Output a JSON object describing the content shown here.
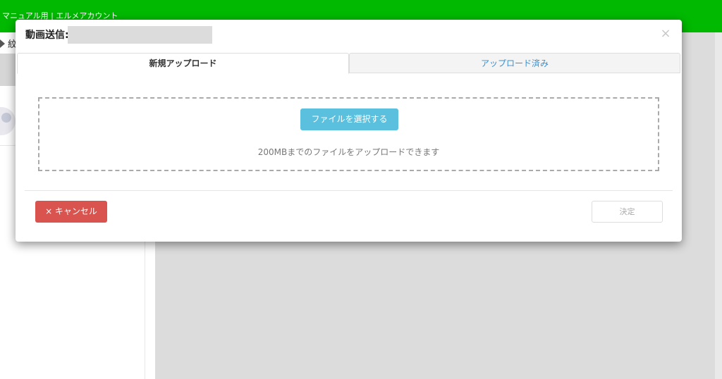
{
  "app": {
    "title": "マニュアル用 | エルメアカウント",
    "brand_color": "#00b900"
  },
  "sidebar": {
    "label": "紋"
  },
  "modal": {
    "title": "動画送信:",
    "close_icon": "close-icon",
    "tabs": [
      {
        "label": "新規アップロード",
        "active": true
      },
      {
        "label": "アップロード済み",
        "active": false
      }
    ],
    "dropzone": {
      "select_button_label": "ファイルを選択する",
      "hint": "200MBまでのファイルをアップロードできます"
    },
    "footer": {
      "cancel_label": "× キャンセル",
      "confirm_label": "決定"
    },
    "colors": {
      "select_button": "#5bc0de",
      "cancel_button": "#d9534f",
      "inactive_tab_text": "#3a8fd0"
    }
  }
}
